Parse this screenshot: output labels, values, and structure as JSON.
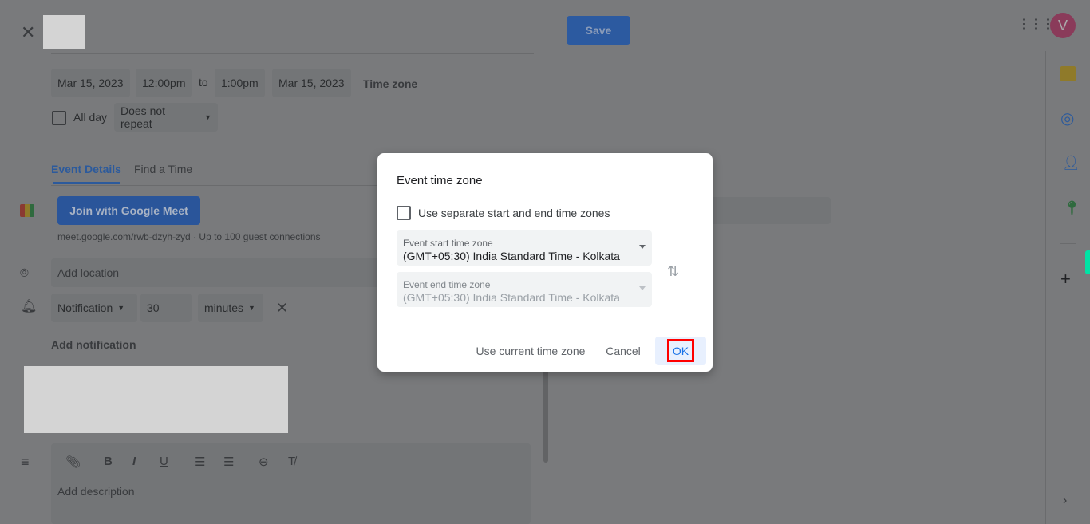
{
  "header": {
    "save_label": "Save",
    "avatar_letter": "V"
  },
  "datetime": {
    "start_date": "Mar 15, 2023",
    "start_time": "12:00pm",
    "to": "to",
    "end_time": "1:00pm",
    "end_date": "Mar 15, 2023",
    "time_zone": "Time zone",
    "all_day": "All day",
    "repeat": "Does not repeat"
  },
  "tabs": [
    {
      "label": "Event Details",
      "active": true
    },
    {
      "label": "Find a Time",
      "active": false
    }
  ],
  "meet": {
    "button": "Join with Google Meet",
    "info": "meet.google.com/rwb-dzyh-zyd · Up to 100 guest connections"
  },
  "location": {
    "placeholder": "Add location"
  },
  "notification": {
    "type": "Notification",
    "value": "30",
    "unit": "minutes",
    "add": "Add notification"
  },
  "description": {
    "placeholder": "Add description"
  },
  "dialog": {
    "title": "Event time zone",
    "separate_label": "Use separate start and end time zones",
    "start_label": "Event start time zone",
    "start_value": "(GMT+05:30) India Standard Time - Kolkata",
    "end_label": "Event end time zone",
    "end_value": "(GMT+05:30) India Standard Time - Kolkata",
    "use_current": "Use current time zone",
    "cancel": "Cancel",
    "ok": "OK"
  },
  "colors": {
    "accent": "#1a73e8",
    "highlight": "#ff0000"
  }
}
